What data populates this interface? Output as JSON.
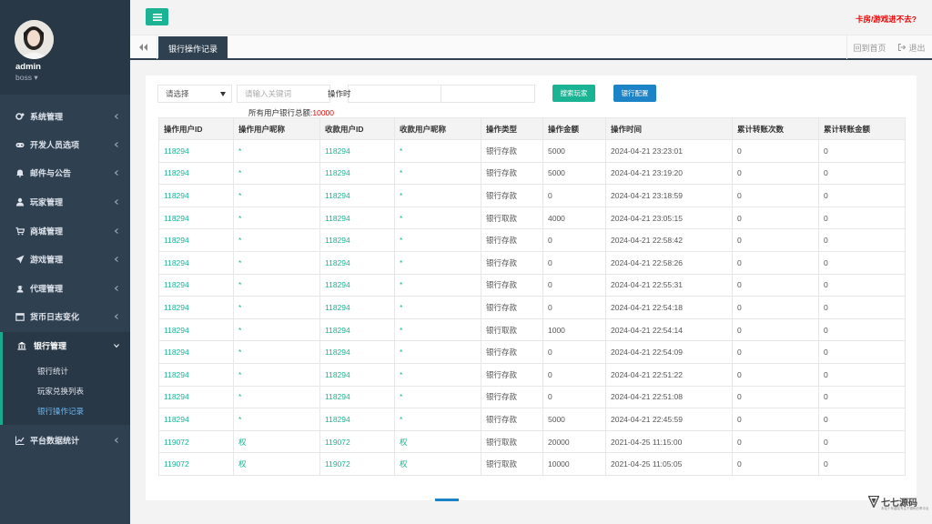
{
  "sidebar": {
    "user": {
      "name": "admin",
      "role": "boss"
    },
    "items": [
      {
        "label": "系统管理",
        "icon": "gears-icon"
      },
      {
        "label": "开发人员选项",
        "icon": "gamepad-icon"
      },
      {
        "label": "邮件与公告",
        "icon": "bell-icon"
      },
      {
        "label": "玩家管理",
        "icon": "user-icon"
      },
      {
        "label": "商城管理",
        "icon": "cart-icon"
      },
      {
        "label": "游戏管理",
        "icon": "rocket-icon"
      },
      {
        "label": "代理管理",
        "icon": "agent-icon"
      },
      {
        "label": "货币日志变化",
        "icon": "calendar-icon"
      },
      {
        "label": "银行管理",
        "icon": "bank-icon"
      },
      {
        "label": "平台数据统计",
        "icon": "chart-icon"
      }
    ],
    "bank_sub": [
      {
        "label": "银行统计"
      },
      {
        "label": "玩家兑换列表"
      },
      {
        "label": "银行操作记录"
      }
    ]
  },
  "topbar": {
    "warning": "卡房/游戏进不去?"
  },
  "tabs": {
    "active": "银行操作记录",
    "home": "回到首页",
    "logout": "退出"
  },
  "filter": {
    "select_value": "请选择",
    "keyword_placeholder": "请输入关键词",
    "time_label": "操作时",
    "search_button": "搜索玩家",
    "config_button": "银行配置",
    "total_label": "所有用户银行总额:",
    "total_value": "10000"
  },
  "table": {
    "headers": [
      "操作用户ID",
      "操作用户昵称",
      "收款用户ID",
      "收款用户昵称",
      "操作类型",
      "操作金额",
      "操作时间",
      "累计转账次数",
      "累计转账金额"
    ],
    "rows": [
      [
        "118294",
        "*",
        "118294",
        "*",
        "银行存款",
        "5000",
        "2024-04-21 23:23:01",
        "0",
        "0"
      ],
      [
        "118294",
        "*",
        "118294",
        "*",
        "银行存款",
        "5000",
        "2024-04-21 23:19:20",
        "0",
        "0"
      ],
      [
        "118294",
        "*",
        "118294",
        "*",
        "银行存款",
        "0",
        "2024-04-21 23:18:59",
        "0",
        "0"
      ],
      [
        "118294",
        "*",
        "118294",
        "*",
        "银行取款",
        "4000",
        "2024-04-21 23:05:15",
        "0",
        "0"
      ],
      [
        "118294",
        "*",
        "118294",
        "*",
        "银行存款",
        "0",
        "2024-04-21 22:58:42",
        "0",
        "0"
      ],
      [
        "118294",
        "*",
        "118294",
        "*",
        "银行存款",
        "0",
        "2024-04-21 22:58:26",
        "0",
        "0"
      ],
      [
        "118294",
        "*",
        "118294",
        "*",
        "银行存款",
        "0",
        "2024-04-21 22:55:31",
        "0",
        "0"
      ],
      [
        "118294",
        "*",
        "118294",
        "*",
        "银行存款",
        "0",
        "2024-04-21 22:54:18",
        "0",
        "0"
      ],
      [
        "118294",
        "*",
        "118294",
        "*",
        "银行取款",
        "1000",
        "2024-04-21 22:54:14",
        "0",
        "0"
      ],
      [
        "118294",
        "*",
        "118294",
        "*",
        "银行存款",
        "0",
        "2024-04-21 22:54:09",
        "0",
        "0"
      ],
      [
        "118294",
        "*",
        "118294",
        "*",
        "银行存款",
        "0",
        "2024-04-21 22:51:22",
        "0",
        "0"
      ],
      [
        "118294",
        "*",
        "118294",
        "*",
        "银行存款",
        "0",
        "2024-04-21 22:51:08",
        "0",
        "0"
      ],
      [
        "118294",
        "*",
        "118294",
        "*",
        "银行存款",
        "5000",
        "2024-04-21 22:45:59",
        "0",
        "0"
      ],
      [
        "119072",
        "权",
        "119072",
        "权",
        "银行取款",
        "20000",
        "2021-04-25 11:15:00",
        "0",
        "0"
      ],
      [
        "119072",
        "权",
        "119072",
        "权",
        "银行取款",
        "10000",
        "2021-04-25 11:05:05",
        "0",
        "0"
      ]
    ]
  },
  "watermark": {
    "text": "七七源码",
    "sub": "本站十年建站专注于源码分享平台"
  },
  "colors": {
    "sidebar": "#2f4050",
    "accent": "#1ab394",
    "primary": "#1c84c6",
    "warning": "#ed0000",
    "active_sub": "#69b5f0"
  }
}
